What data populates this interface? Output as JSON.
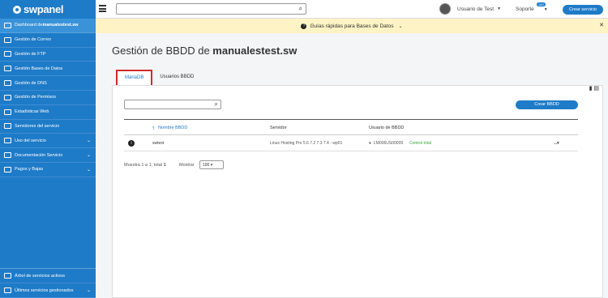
{
  "brand": {
    "name": "swpanel"
  },
  "sidebar": {
    "items": [
      {
        "label": "Dashboard de ",
        "label_bold": "manualestest.sw"
      },
      {
        "label": "Gestión de Correo"
      },
      {
        "label": "Gestión de FTP"
      },
      {
        "label": "Gestión Bases de Datos"
      },
      {
        "label": "Gestión de DNS"
      },
      {
        "label": "Gestión de Permisos"
      },
      {
        "label": "Estadísticas Web"
      },
      {
        "label": "Servidores del servicio"
      },
      {
        "label": "Uso del servicio"
      },
      {
        "label": "Documentación Servicio"
      },
      {
        "label": "Pagos y Bajas"
      }
    ],
    "bottom": [
      {
        "label": "Árbol de servicios activos"
      },
      {
        "label": "Últimos servicios gestionados"
      }
    ]
  },
  "topbar": {
    "user": "Usuario de Test",
    "support": "Soporte",
    "support_badge": "140",
    "create_service": "Crear servicio"
  },
  "banner": {
    "text": "Guías rápidas para Bases de Datos",
    "q": "?",
    "close": "✕"
  },
  "page": {
    "title_prefix": "Gestión de BBDD de ",
    "title_bold": "manualestest.sw"
  },
  "tabs": [
    {
      "label": "MariaDB"
    },
    {
      "label": "Usuarios BBDD"
    }
  ],
  "table": {
    "create_button": "Crear BBDD",
    "headers": [
      "Nombre BBDD",
      "Servidor",
      "Usuario de BBDD"
    ],
    "rows": [
      {
        "info": "i",
        "name": "swtest",
        "server": "Linux Hosting Pro 5.6 7.2 7.3 7.4 - wp01",
        "user": "LM006US00009",
        "user_link": "Control total",
        "actions": "...▾"
      }
    ]
  },
  "footer": {
    "summary": "Muestra 1 a 1; total",
    "summary_total": "1",
    "show_label": "Mostrar",
    "page_size": "100 ▾"
  }
}
